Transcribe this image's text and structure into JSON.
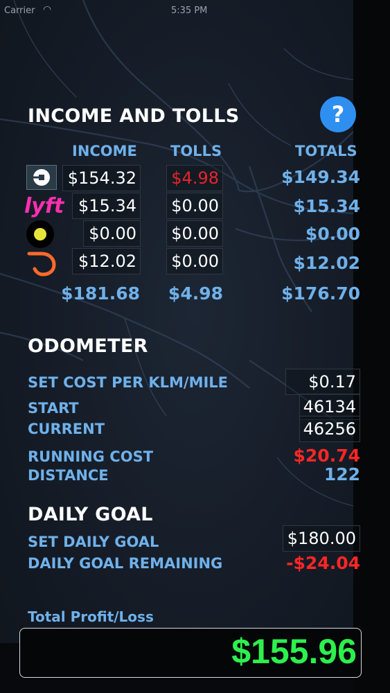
{
  "status_bar": {
    "carrier": "Carrier",
    "time": "5:35 PM"
  },
  "income_tolls": {
    "title": "INCOME AND TOLLS",
    "help_label": "?",
    "headers": {
      "income": "INCOME",
      "tolls": "TOLLS",
      "totals": "TOTALS"
    },
    "rows": [
      {
        "service": "uber-icon",
        "income": "$154.32",
        "tolls": "$4.98",
        "total": "$149.34"
      },
      {
        "service": "lyft-icon",
        "income": "$15.34",
        "tolls": "$0.00",
        "total": "$15.34"
      },
      {
        "service": "curb-icon",
        "income": "$0.00",
        "tolls": "$0.00",
        "total": "$0.00"
      },
      {
        "service": "doordash-icon",
        "income": "$12.02",
        "tolls": "$0.00",
        "total": "$12.02"
      }
    ],
    "lyft_logo_text": "lyft",
    "sum": {
      "income": "$181.68",
      "tolls": "$4.98",
      "total": "$176.70"
    }
  },
  "odometer": {
    "title": "ODOMETER",
    "cost_label": "SET COST PER KLM/MILE",
    "cost_value": "$0.17",
    "start_label": "START",
    "start_value": "46134",
    "current_label": "CURRENT",
    "current_value": "46256",
    "running_cost_label": "RUNNING COST",
    "running_cost_value": "$20.74",
    "distance_label": "DISTANCE",
    "distance_value": "122"
  },
  "daily_goal": {
    "title": "DAILY GOAL",
    "set_label": "SET DAILY GOAL",
    "set_value": "$180.00",
    "remaining_label": "DAILY GOAL REMAINING",
    "remaining_value": "-$24.04"
  },
  "profit": {
    "label": "Total Profit/Loss",
    "value": "$155.96"
  },
  "colors": {
    "accent": "#6fb1ea",
    "negative": "#ff2626",
    "positive": "#2df04c",
    "help": "#2e8ff0"
  }
}
